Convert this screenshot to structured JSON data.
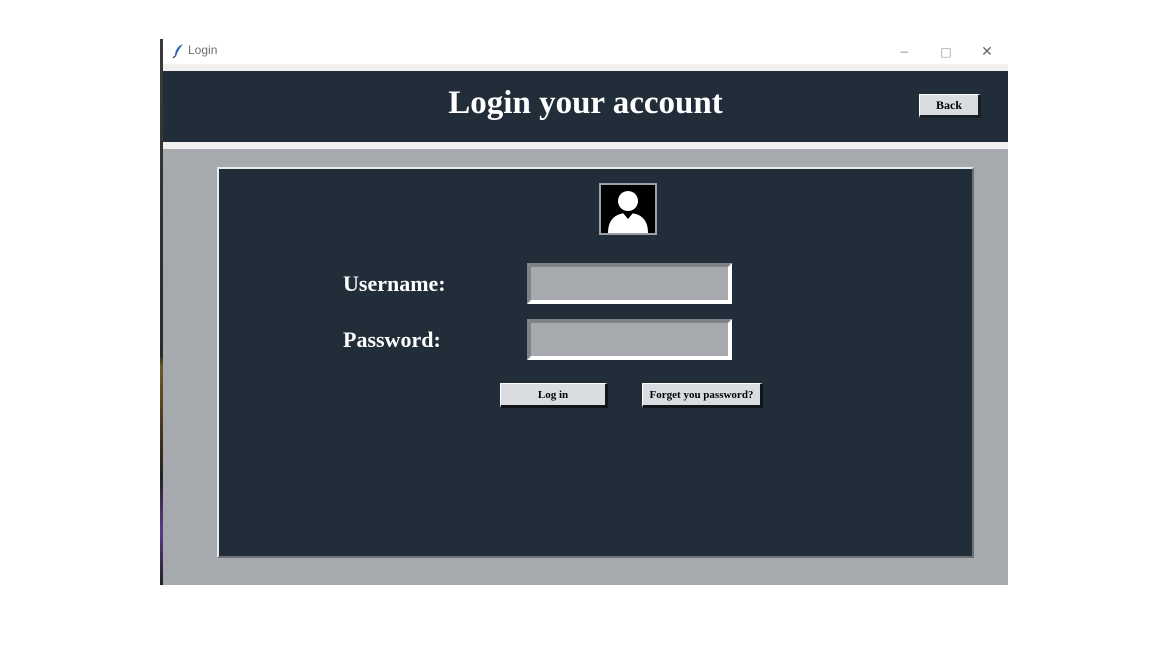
{
  "window": {
    "title": "Login",
    "app_icon": "feather-icon",
    "controls": {
      "minimize": "−",
      "maximize": "□",
      "close": "✕"
    }
  },
  "header": {
    "title": "Login your account",
    "back_label": "Back"
  },
  "form": {
    "avatar_icon": "user-avatar-icon",
    "username_label": "Username:",
    "username_value": "",
    "password_label": "Password:",
    "password_value": "",
    "login_label": "Log in",
    "forgot_label": "Forget you password?"
  },
  "colors": {
    "header_bg": "#222d3a",
    "panel_bg": "#222d3a",
    "window_bg": "#a6aaae",
    "button_bg": "#d9dce0"
  }
}
